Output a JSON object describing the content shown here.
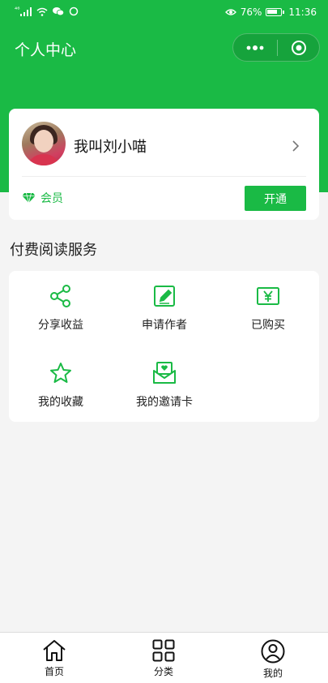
{
  "status_bar": {
    "signal_text": "⁴⁶",
    "battery_percent": "76%",
    "time": "11:36",
    "icons": [
      "signal-icon",
      "wifi-icon",
      "wechat-icon",
      "circle-icon",
      "eye-icon",
      "battery-icon"
    ]
  },
  "header": {
    "title": "个人中心",
    "capsule_icons": [
      "more-icon",
      "target-icon"
    ]
  },
  "profile": {
    "username": "我叫刘小喵",
    "member_label": "会员",
    "open_button": "开通"
  },
  "services": {
    "title": "付费阅读服务",
    "items": [
      {
        "label": "分享收益",
        "icon": "share-icon"
      },
      {
        "label": "申请作者",
        "icon": "edit-icon"
      },
      {
        "label": "已购买",
        "icon": "yen-icon"
      },
      {
        "label": "我的收藏",
        "icon": "star-icon"
      },
      {
        "label": "我的邀请卡",
        "icon": "invite-card-icon"
      }
    ]
  },
  "tabbar": {
    "items": [
      {
        "label": "首页",
        "icon": "home-icon"
      },
      {
        "label": "分类",
        "icon": "grid-icon"
      },
      {
        "label": "我的",
        "icon": "user-icon"
      }
    ]
  },
  "colors": {
    "brand_green": "#1aba45",
    "background": "#f4f4f4"
  }
}
